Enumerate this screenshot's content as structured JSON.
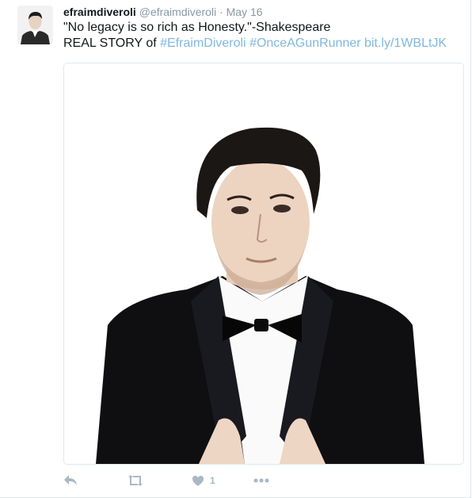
{
  "tweet": {
    "display_name": "efraimdiveroli",
    "handle": "@efraimdiveroli",
    "separator": "·",
    "date": "May 16",
    "line1": "\"No legacy is so rich as Honesty.\"-Shakespeare",
    "line2_prefix": "REAL STORY of ",
    "hashtag1": "#EfraimDiveroli",
    "hashtag2": "#OnceAGunRunner",
    "url": "bit.ly/1WBLtJK",
    "like_count": "1"
  },
  "icons": {
    "reply": "reply-icon",
    "retweet": "retweet-icon",
    "like": "heart-icon",
    "more": "more-icon"
  },
  "colors": {
    "link": "#7fb8e0",
    "muted": "#8899a6",
    "action": "#aab8c2"
  }
}
